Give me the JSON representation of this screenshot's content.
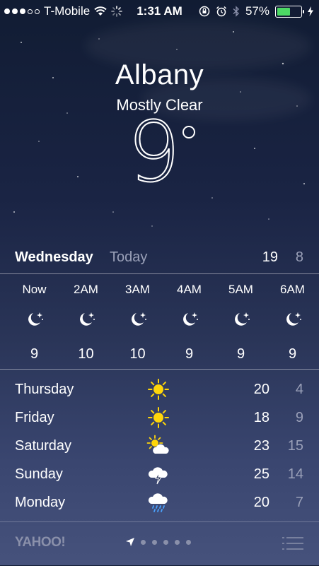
{
  "status_bar": {
    "carrier": "T-Mobile",
    "time": "1:31 AM",
    "battery_percent": "57%",
    "battery_level": 0.57,
    "signal_bars_filled": 3,
    "signal_bars_total": 5,
    "battery_color": "#4cd964",
    "icons": [
      "wifi-icon",
      "activity-spinner-icon",
      "orientation-lock-icon",
      "alarm-icon",
      "bluetooth-icon",
      "charging-icon"
    ]
  },
  "location": {
    "city": "Albany",
    "condition": "Mostly Clear",
    "temperature": "9"
  },
  "today": {
    "day": "Wednesday",
    "label": "Today",
    "high": "19",
    "low": "8"
  },
  "hourly": [
    {
      "time": "Now",
      "icon": "moon-stars-icon",
      "temp": "9"
    },
    {
      "time": "2AM",
      "icon": "moon-stars-icon",
      "temp": "10"
    },
    {
      "time": "3AM",
      "icon": "moon-stars-icon",
      "temp": "10"
    },
    {
      "time": "4AM",
      "icon": "moon-stars-icon",
      "temp": "9"
    },
    {
      "time": "5AM",
      "icon": "moon-stars-icon",
      "temp": "9"
    },
    {
      "time": "6AM",
      "icon": "moon-stars-icon",
      "temp": "9"
    }
  ],
  "daily": [
    {
      "day": "Thursday",
      "icon": "sun-icon",
      "high": "20",
      "low": "4"
    },
    {
      "day": "Friday",
      "icon": "sun-icon",
      "high": "18",
      "low": "9"
    },
    {
      "day": "Saturday",
      "icon": "partly-cloudy-icon",
      "high": "23",
      "low": "15"
    },
    {
      "day": "Sunday",
      "icon": "thunderstorm-icon",
      "high": "25",
      "low": "14"
    },
    {
      "day": "Monday",
      "icon": "rain-icon",
      "high": "20",
      "low": "7"
    }
  ],
  "footer": {
    "brand": "YAHOO!",
    "page_count": 5,
    "current_page_indicator": "location-arrow-icon",
    "menu_icon": "list-menu-icon"
  },
  "colors": {
    "sun": "#ffd60a",
    "secondary_text": "#9aa0b8",
    "rain": "#4aa3ff"
  }
}
